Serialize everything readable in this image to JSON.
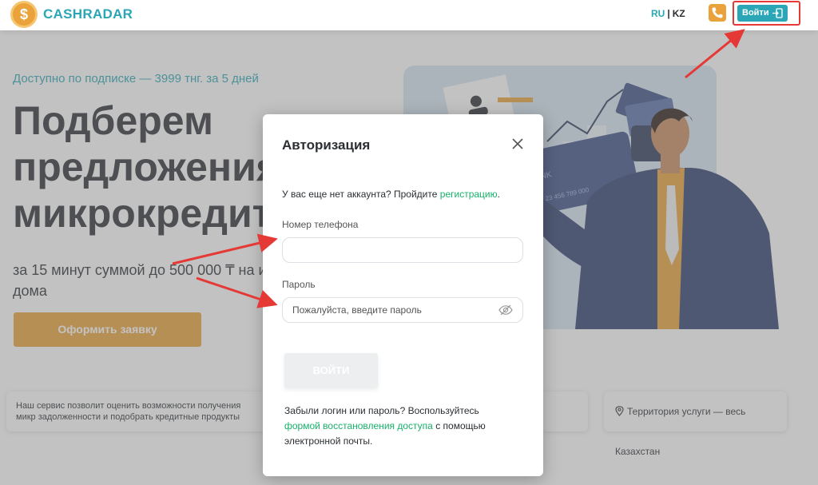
{
  "header": {
    "logo_symbol": "$",
    "logo_text": "CASHRADAR",
    "lang_ru": "RU",
    "lang_sep": "|",
    "lang_kz": "KZ",
    "login_label": "Войти"
  },
  "hero": {
    "subscription": "Доступно по подписке — 3999 тнг. за 5 дней",
    "title": "Подберем предложения микрокредита",
    "subtitle": "за 15 минут суммой до 500 000 ₸ на из дома",
    "apply_button": "Оформить заявку"
  },
  "info": {
    "left_text": "Наш сервис позволит оценить возможности получения микр задолженности и подобрать кредитные продукты",
    "right_text": "Территория услуги — весь Казахстан"
  },
  "modal": {
    "title": "Авторизация",
    "no_account_text": "У вас еще нет аккаунта? Пройдите ",
    "register_link": "регистрацию",
    "no_account_end": ".",
    "phone_label": "Номер телефона",
    "phone_value": "",
    "password_label": "Пароль",
    "password_placeholder": "Пожалуйста, введите пароль",
    "submit": "ВОЙТИ",
    "forgot_text": "Забыли логин или пароль? Воспользуйтесь ",
    "recovery_link": "формой восстановления доступа",
    "forgot_end": " с помощью электронной почты."
  },
  "illustration": {
    "card_text": "NK",
    "card_number": "23 456 789 000"
  },
  "colors": {
    "brand": "#2aa6b6",
    "accent": "#e9a33a",
    "link": "#17b26a",
    "annotation": "#e53935"
  }
}
